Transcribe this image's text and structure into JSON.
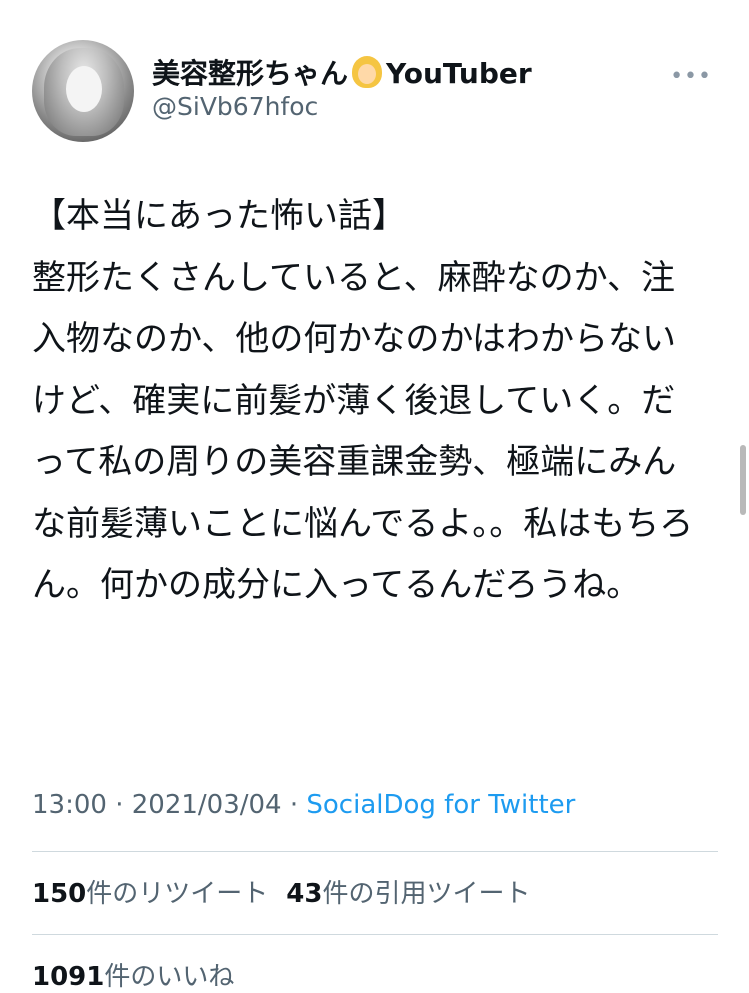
{
  "user": {
    "display_name": "美容整形ちゃん",
    "display_name_suffix": "YouTuber",
    "emoji": "woman-blond-hair-emoji",
    "handle": "@SiVb67hfoc",
    "more_icon": "•••"
  },
  "tweet": {
    "text": "【本当にあった怖い話】\n整形たくさんしていると、麻酔なのか、注入物なのか、他の何かなのかはわからないけど、確実に前髪が薄く後退していく。だって私の周りの美容重課金勢、極端にみんな前髪薄いことに悩んでるよ。。私はもちろん。何かの成分に入ってるんだろうね。"
  },
  "meta": {
    "time": "13:00",
    "sep1": " · ",
    "date": "2021/03/04",
    "sep2": " · ",
    "source": "SocialDog for Twitter"
  },
  "stats": {
    "retweets_count": "150",
    "retweets_label": "件のリツイート",
    "quotes_count": "43",
    "quotes_label": "件の引用ツイート"
  },
  "likes": {
    "count": "1091",
    "label": "件のいいね"
  },
  "colors": {
    "text": "#0f1419",
    "secondary": "#536471",
    "link": "#1d9bf0",
    "divider": "#cfd9de"
  }
}
